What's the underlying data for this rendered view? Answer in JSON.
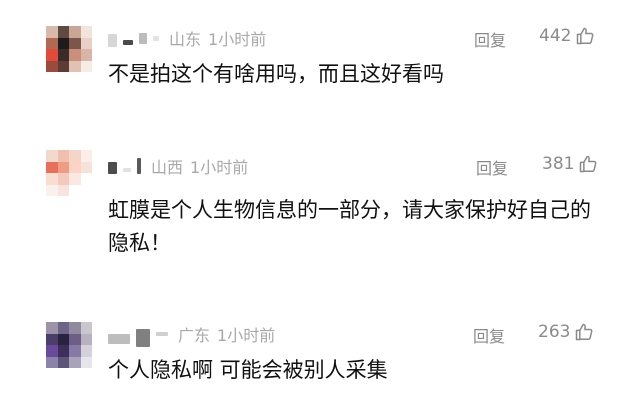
{
  "comments": [
    {
      "location": "山东",
      "time": "1小时前",
      "reply_label": "回复",
      "likes": "442",
      "text": "不是拍这个有啥用吗，而且这好看吗"
    },
    {
      "location": "山西",
      "time": "1小时前",
      "reply_label": "回复",
      "likes": "381",
      "text": "虹膜是个人生物信息的一部分，请大家保护好自己的隐私！"
    },
    {
      "location": "广东",
      "time": "1小时前",
      "reply_label": "回复",
      "likes": "263",
      "text": "个人隐私啊 可能会被别人采集"
    }
  ],
  "icons": {
    "like": "thumbs-up-icon"
  },
  "colors": {
    "meta_text": "#a9a9a9",
    "action_text": "#8a8a8a",
    "body_text": "#111111"
  }
}
